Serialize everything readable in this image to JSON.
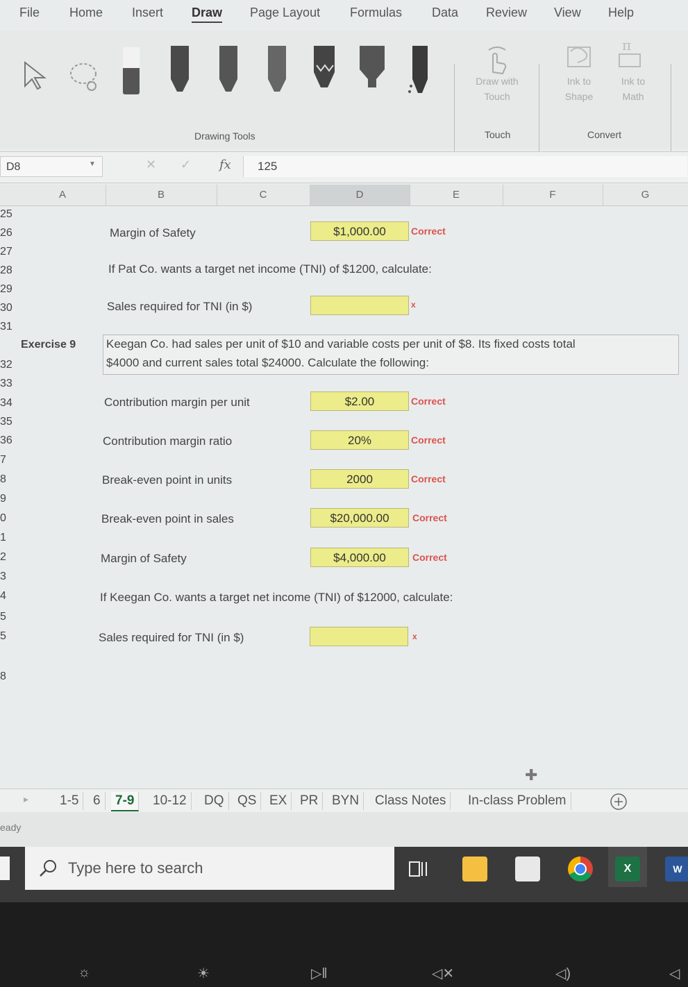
{
  "ribbon": {
    "tabs": [
      "File",
      "Home",
      "Insert",
      "Draw",
      "Page Layout",
      "Formulas",
      "Data",
      "Review",
      "View",
      "Help"
    ],
    "active_tab": "Draw",
    "drawing_tools_label": "Drawing Tools",
    "draw_with_touch_label": "Draw with Touch",
    "touch_group_label": "Touch",
    "ink_to_shape_label": "Ink to Shape",
    "ink_to_math_label": "Ink to Math",
    "convert_group_label": "Convert"
  },
  "formula_bar": {
    "name_box": "D8",
    "fx": "fx",
    "value": "125"
  },
  "columns": [
    "A",
    "B",
    "C",
    "D",
    "E",
    "F",
    "G"
  ],
  "selected_column": "D",
  "rows": [
    "25",
    "26",
    "27",
    "28",
    "29",
    "30",
    "31",
    "32",
    "33",
    "34",
    "35",
    "36",
    "7",
    "8",
    "9",
    "0",
    "1",
    "2",
    "3",
    "4",
    "5",
    "5",
    "8"
  ],
  "sheet": {
    "items": [
      {
        "label": "Margin of Safety",
        "value": "$1,000.00",
        "status": "Correct"
      },
      {
        "label": "If Pat Co. wants a target net income (TNI) of $1200, calculate:"
      },
      {
        "label": "Sales required for TNI (in $)",
        "value": "",
        "status": "x"
      }
    ],
    "exercise_label": "Exercise 9",
    "exercise_text_1": "Keegan Co. had sales per unit of $10 and variable costs per unit of $8.  Its fixed costs total",
    "exercise_text_2": "$4000 and current sales total $24000.  Calculate the following:",
    "ex9": [
      {
        "label": "Contribution margin per unit",
        "value": "$2.00",
        "status": "Correct"
      },
      {
        "label": "Contribution margin ratio",
        "value": "20%",
        "status": "Correct"
      },
      {
        "label": "Break-even point in units",
        "value": "2000",
        "status": "Correct"
      },
      {
        "label": "Break-even point in sales",
        "value": "$20,000.00",
        "status": "Correct"
      },
      {
        "label": "Margin of Safety",
        "value": "$4,000.00",
        "status": "Correct"
      }
    ],
    "tni_prompt": "If Keegan Co. wants a target net income (TNI) of $12000, calculate:",
    "tni_label": "Sales required for TNI (in $)",
    "tni_status": "x"
  },
  "sheet_tabs": [
    "1-5",
    "6",
    "7-9",
    "10-12",
    "DQ",
    "QS",
    "EX",
    "PR",
    "BYN",
    "Class Notes",
    "In-class Problem"
  ],
  "active_sheet": "7-9",
  "status_text": "eady",
  "taskbar": {
    "search_placeholder": "Type here to search"
  },
  "colors": {
    "input_fill": "#ecec8a",
    "correct": "#d9534f",
    "excel_green": "#1e6b3a"
  }
}
